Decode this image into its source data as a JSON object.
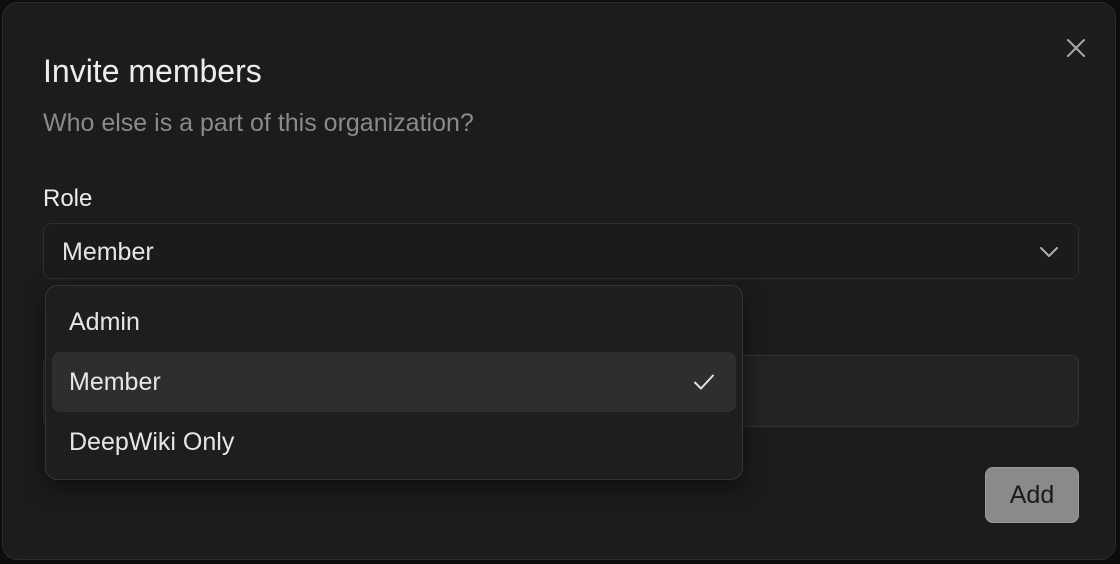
{
  "dialog": {
    "title": "Invite members",
    "subtitle": "Who else is a part of this organization?"
  },
  "role": {
    "label": "Role",
    "selected_value": "Member",
    "options": [
      {
        "label": "Admin",
        "selected": false
      },
      {
        "label": "Member",
        "selected": true
      },
      {
        "label": "DeepWiki Only",
        "selected": false
      }
    ]
  },
  "actions": {
    "add_label": "Add"
  },
  "icons": {
    "close": "close-icon",
    "chevron": "chevron-down-icon",
    "check": "check-icon"
  },
  "colors": {
    "background": "#1c1c1c",
    "selected_option": "#2e2e2e",
    "add_button": "#8a8a8a"
  }
}
